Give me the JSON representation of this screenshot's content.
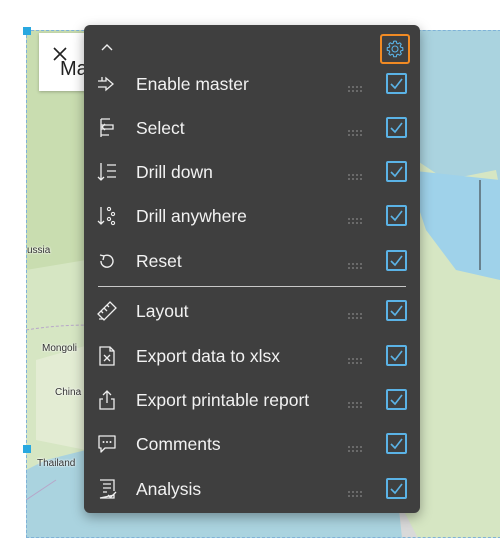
{
  "widget": {
    "title_partial": "Ma",
    "map_labels": {
      "russia": "ussia",
      "mongolia": "Mongoli",
      "china": "China",
      "thailand": "Thailand"
    }
  },
  "menu": {
    "items": [
      {
        "label": "Enable master",
        "icon": "enable-master-icon",
        "checked": true
      },
      {
        "label": "Select",
        "icon": "select-icon",
        "checked": true
      },
      {
        "label": "Drill down",
        "icon": "drill-down-icon",
        "checked": true
      },
      {
        "label": "Drill anywhere",
        "icon": "drill-anywhere-icon",
        "checked": true
      },
      {
        "label": "Reset",
        "icon": "reset-icon",
        "checked": true
      },
      {
        "label": "Layout",
        "icon": "layout-icon",
        "checked": true
      },
      {
        "label": "Export data to xlsx",
        "icon": "export-xlsx-icon",
        "checked": true
      },
      {
        "label": "Export printable report",
        "icon": "export-report-icon",
        "checked": true
      },
      {
        "label": "Comments",
        "icon": "comments-icon",
        "checked": true
      },
      {
        "label": "Analysis",
        "icon": "analysis-icon",
        "checked": true
      }
    ]
  },
  "colors": {
    "menu_bg": "#3f3f3f",
    "checkbox": "#5bb3e6",
    "settings_highlight": "#f08a24",
    "map_water": "#aad3df",
    "map_land": "#d6e6c3"
  }
}
